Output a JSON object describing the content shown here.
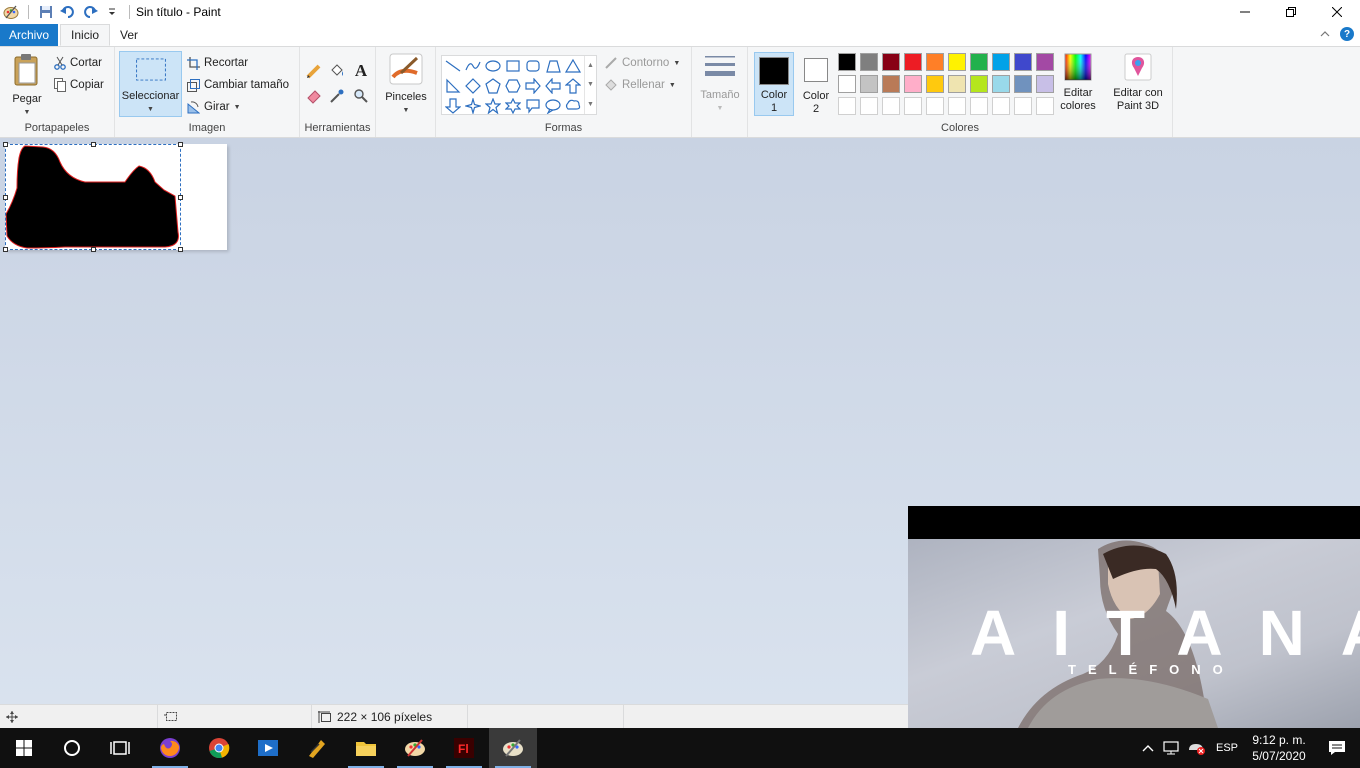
{
  "window": {
    "title": "Sin título - Paint",
    "icons": [
      "paint-app-icon",
      "save-icon",
      "undo-icon",
      "redo-icon",
      "customize-dropdown-icon"
    ]
  },
  "tabs": {
    "file": "Archivo",
    "home": "Inicio",
    "view": "Ver"
  },
  "ribbon": {
    "clipboard": {
      "label": "Portapapeles",
      "paste": "Pegar",
      "cut": "Cortar",
      "copy": "Copiar"
    },
    "image": {
      "label": "Imagen",
      "select": "Seleccionar",
      "crop": "Recortar",
      "resize": "Cambiar tamaño",
      "rotate": "Girar"
    },
    "tools": {
      "label": "Herramientas"
    },
    "brushes": "Pinceles",
    "shapes": {
      "label": "Formas",
      "outline": "Contorno",
      "fill": "Rellenar"
    },
    "size": "Tamaño",
    "colors": {
      "label": "Colores",
      "color1": "Color 1",
      "color2": "Color 2",
      "edit_colors": "Editar colores",
      "edit_paint3d": "Editar con Paint 3D",
      "color1_value": "#000000",
      "color2_value": "#ffffff",
      "palette_row1": [
        "#000000",
        "#7f7f7f",
        "#880015",
        "#ed1c24",
        "#ff7f27",
        "#fff200",
        "#22b14c",
        "#00a2e8",
        "#3f48cc",
        "#a349a4"
      ],
      "palette_row2": [
        "#ffffff",
        "#c3c3c3",
        "#b97a57",
        "#ffaec9",
        "#ffc90e",
        "#efe4b0",
        "#b5e61d",
        "#99d9ea",
        "#7092be",
        "#c8bfe7"
      ]
    }
  },
  "statusbar": {
    "dimensions": "222 × 106 píxeles"
  },
  "video": {
    "title": "AITANA",
    "subtitle": "TELÉFONO"
  },
  "taskbar": {
    "language": "ESP",
    "time": "9:12 p. m.",
    "date": "5/07/2020"
  }
}
